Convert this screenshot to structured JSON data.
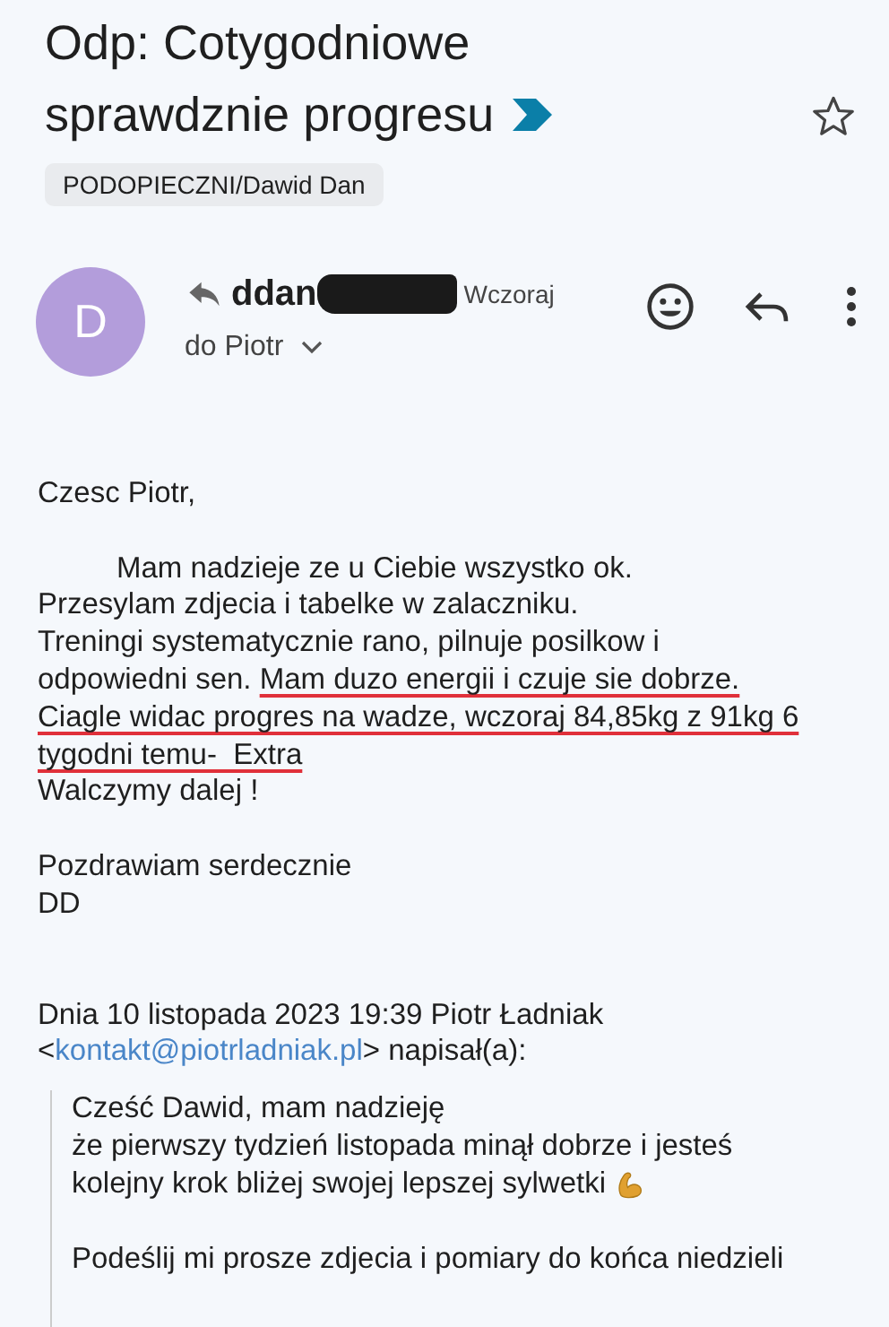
{
  "subject": {
    "lines": [
      "Odp: Cotygodniowe",
      "sprawdznie progresu"
    ],
    "important": true,
    "starred": false
  },
  "label": "PODOPIECZNI/Dawid Dan",
  "message": {
    "avatar": "D",
    "color": "#b39ddb",
    "sender": "ddan",
    "date": "Wczoraj",
    "recipient": "do Piotr"
  },
  "body": [
    [
      {
        "indented": false,
        "segments": [
          {
            "text": "Czesc Piotr,",
            "underlined": false
          }
        ]
      }
    ],
    [
      {
        "indented": true,
        "segments": [
          {
            "text": "Mam nadzieje ze u Ciebie wszystko ok.",
            "underlined": false
          }
        ]
      },
      {
        "indented": false,
        "segments": [
          {
            "text": "Przesylam zdjecia i tabelke w zalaczniku.",
            "underlined": false
          }
        ]
      },
      {
        "indented": false,
        "segments": [
          {
            "text": "Treningi systematycznie rano, pilnuje posilkow i",
            "underlined": false
          }
        ]
      },
      {
        "indented": false,
        "segments": [
          {
            "text": "odpowiedni sen. ",
            "underlined": false
          },
          {
            "text": "Mam duzo energii i czuje sie dobrze.",
            "underlined": true
          }
        ]
      },
      {
        "indented": false,
        "segments": [
          {
            "text": "Ciagle widac progres na wadze, wczoraj 84,85kg z 91kg 6",
            "underlined": true
          }
        ]
      },
      {
        "indented": false,
        "segments": [
          {
            "text": "tygodni temu-  Extra",
            "underlined": true
          }
        ]
      },
      {
        "indented": false,
        "segments": [
          {
            "text": "Walczymy dalej !",
            "underlined": false
          }
        ]
      }
    ],
    [
      {
        "indented": false,
        "segments": [
          {
            "text": "Pozdrawiam serdecznie",
            "underlined": false
          }
        ]
      },
      {
        "indented": false,
        "segments": [
          {
            "text": "DD",
            "underlined": false
          }
        ]
      }
    ]
  ],
  "quote_header": [
    [
      {
        "kind": "text",
        "text": "Dnia 10 listopada 2023 19:39 Piotr Ładniak"
      }
    ],
    [
      {
        "kind": "text",
        "text": "<"
      },
      {
        "kind": "link",
        "text": "kontakt@piotrladniak.pl"
      },
      {
        "kind": "text",
        "text": "> napisał(a):"
      }
    ]
  ],
  "quote": [
    [
      {
        "text": "Cześć Dawid, mam nadzieję",
        "emoji": false
      },
      {
        "text": "że pierwszy tydzień listopada minął dobrze i jesteś",
        "emoji": false
      },
      {
        "text": "kolejny krok bliżej swojej lepszej sylwetki",
        "emoji": true
      }
    ],
    [
      {
        "text": "Podeślij mi prosze zdjecia i pomiary do końca niedzieli",
        "emoji": false
      }
    ]
  ]
}
